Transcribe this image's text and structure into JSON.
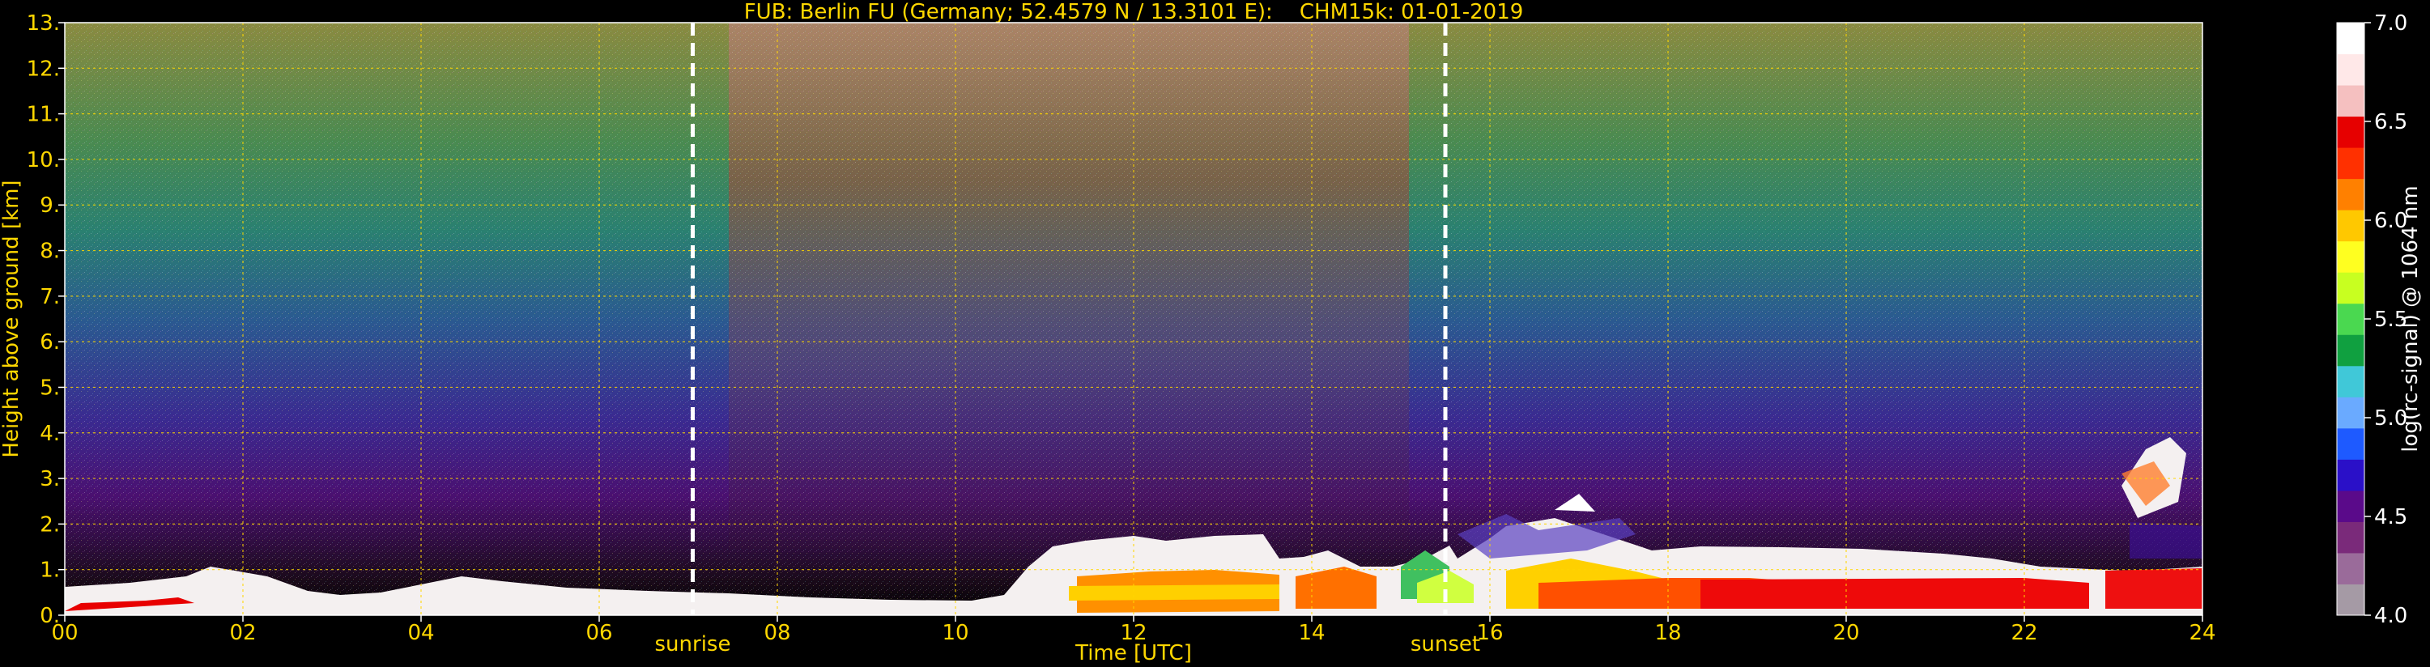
{
  "chart_data": {
    "type": "heatmap",
    "title": "FUB: Berlin FU (Germany; 52.4579 N / 13.3101 E):    CHM15k: 01-01-2019",
    "xlabel": "Time [UTC]",
    "ylabel": "Height above ground [km]",
    "colorbar_label": "log(rc-signal) @ 1064 nm",
    "xlim": [
      0,
      24
    ],
    "ylim": [
      0,
      13
    ],
    "clim": [
      4.0,
      7.0
    ],
    "x_ticks": [
      "00",
      "02",
      "04",
      "06",
      "08",
      "10",
      "12",
      "14",
      "16",
      "18",
      "20",
      "22",
      "24"
    ],
    "x_tick_values": [
      0,
      2,
      4,
      6,
      8,
      10,
      12,
      14,
      16,
      18,
      20,
      22,
      24
    ],
    "y_ticks": [
      "0.",
      "1.",
      "2.",
      "3.",
      "4.",
      "5.",
      "6.",
      "7.",
      "8.",
      "9.",
      "10.",
      "11.",
      "12.",
      "13."
    ],
    "y_tick_values": [
      0,
      1,
      2,
      3,
      4,
      5,
      6,
      7,
      8,
      9,
      10,
      11,
      12,
      13
    ],
    "colorbar_ticks": [
      "4.0",
      "4.5",
      "5.0",
      "5.5",
      "6.0",
      "6.5",
      "7.0"
    ],
    "colorbar_tick_values": [
      4.0,
      4.5,
      5.0,
      5.5,
      6.0,
      6.5,
      7.0
    ],
    "grid": true,
    "annotations": [
      {
        "label": "sunrise",
        "time": 7.05
      },
      {
        "label": "sunset",
        "time": 15.5
      }
    ],
    "colors": {
      "text": "#ffd700",
      "grid": "#ffd700",
      "background": "#000000",
      "sun_lines": "#ffffff",
      "colormap": [
        "#a59aa5",
        "#9a6b9a",
        "#7a2a7a",
        "#5a0a8a",
        "#2a10c8",
        "#1e5aff",
        "#6aaaff",
        "#40c8d8",
        "#10a040",
        "#4ad850",
        "#c8ff20",
        "#ffff20",
        "#ffc800",
        "#ff8000",
        "#ff3000",
        "#e60000",
        "#f5c0c0",
        "#ffe8e8",
        "#ffffff"
      ]
    }
  }
}
